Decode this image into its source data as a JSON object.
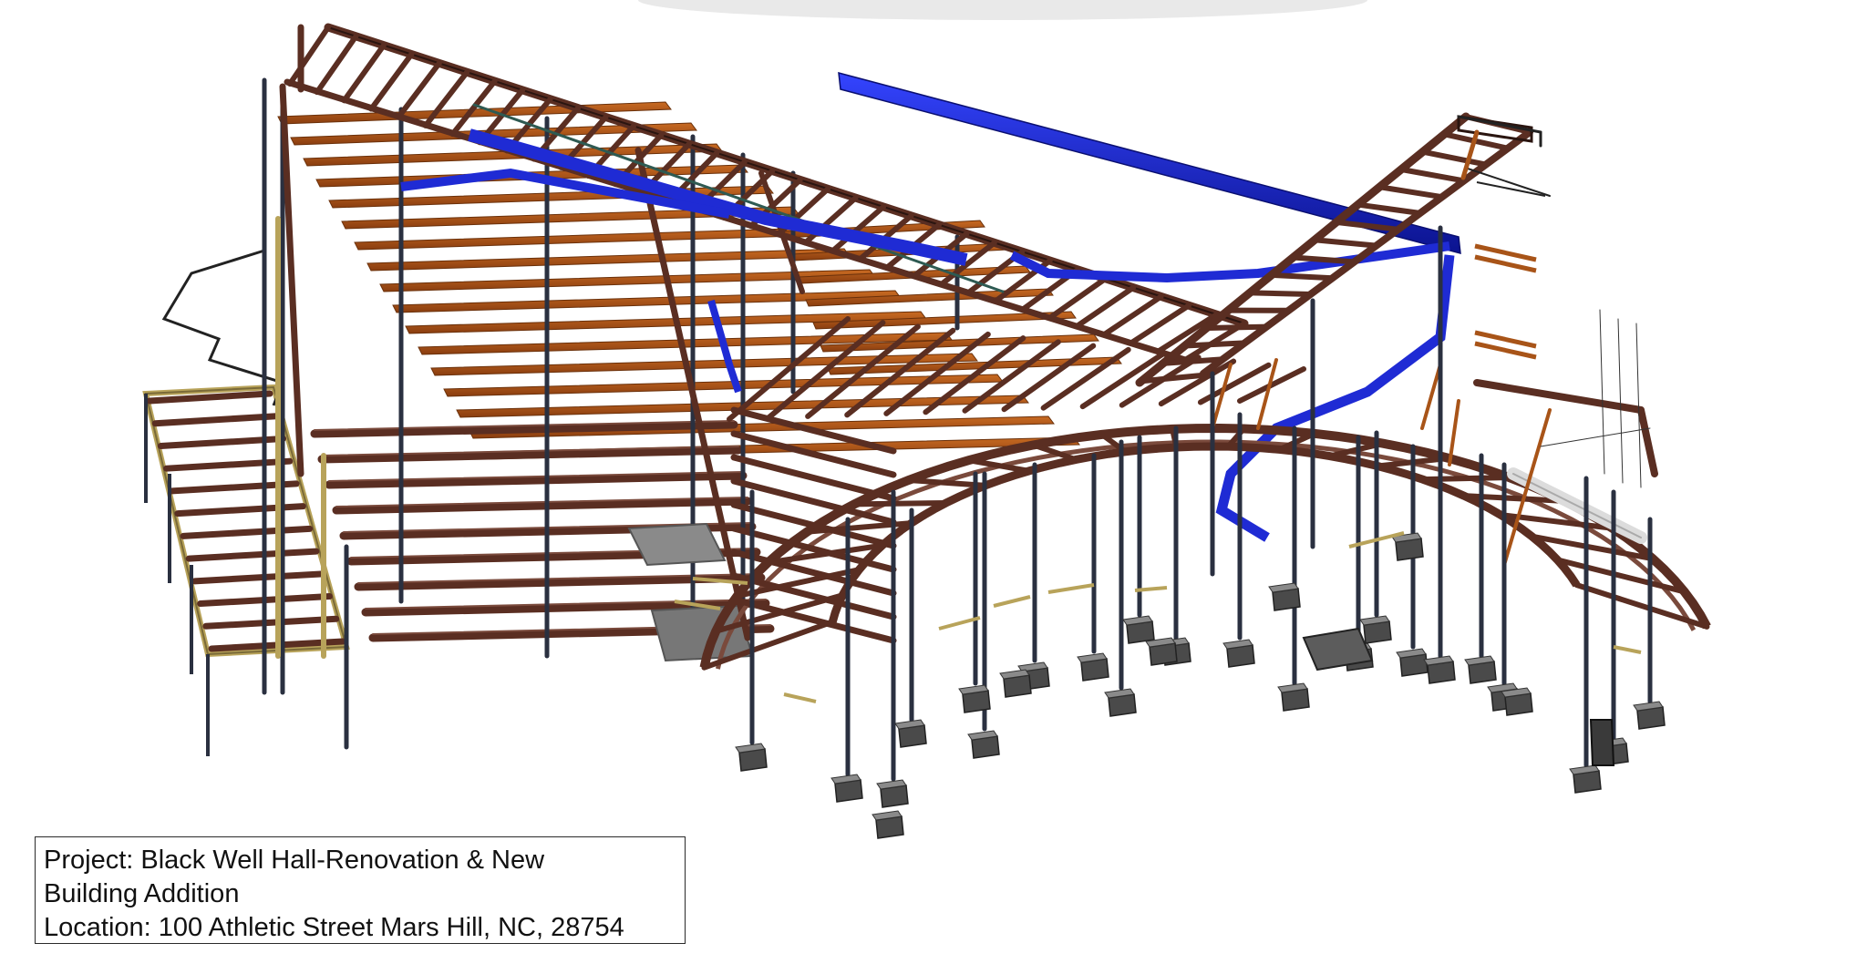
{
  "title_block": {
    "project_line": "Project: Black Well Hall-Renovation & New",
    "project_line_cont": "Building Addition",
    "location_line": "Location: 100 Athletic Street Mars Hill, NC, 28754"
  },
  "colors": {
    "background": "#ffffff",
    "steel_beam": "#5a2e22",
    "steel_beam_light": "#7a4a3c",
    "deck_joist": "#a85418",
    "highlight_beam": "#1f2bd4",
    "column": "#2a3040",
    "footing": "#5c5c5c",
    "brace": "#b8a35a"
  }
}
